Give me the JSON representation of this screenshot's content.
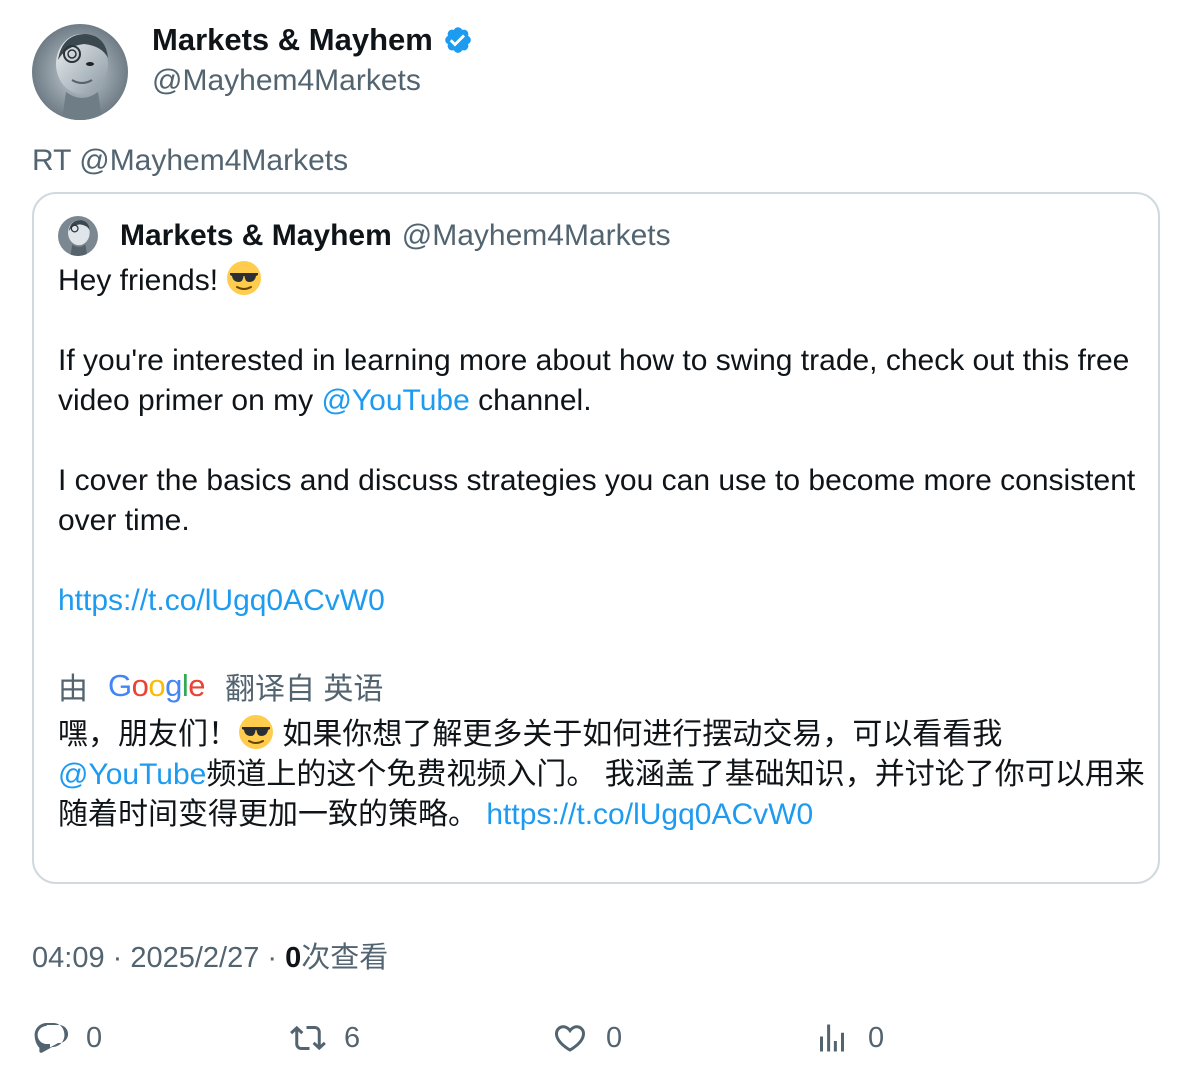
{
  "author": {
    "name": "Markets & Mayhem",
    "handle": "@Mayhem4Markets",
    "verified": true,
    "verified_color": "#1d9bf0"
  },
  "retweet_label": "RT @Mayhem4Markets",
  "quoted": {
    "name": "Markets & Mayhem",
    "handle": "@Mayhem4Markets",
    "line1": "Hey friends!",
    "line1_emoji": "smiling-face-with-sunglasses-icon",
    "para2_a": "If you're interested in learning more about how to swing trade, check out this free video primer on my ",
    "para2_mention": "@YouTube",
    "para2_b": " channel.",
    "para3": "I cover the basics and discuss strategies you can use to become more consistent over time.",
    "link": "https://t.co/lUgq0ACvW0",
    "translation": {
      "prefix": "由",
      "provider": "Google",
      "suffix": "翻译自 英语",
      "part1": "嘿，朋友们！",
      "part2": " 如果你想了解更多关于如何进行摆动交易，可以看看我",
      "mention": "@YouTube",
      "part3": "频道上的这个免费视频入门。 我涵盖了基础知识，并讨论了你可以用来随着时间变得更加一致的策略。 ",
      "link": "https://t.co/lUgq0ACvW0"
    }
  },
  "meta": {
    "time": "04:09",
    "sep1": " · ",
    "date": "2025/2/27",
    "sep2": " · ",
    "views_count": "0",
    "views_label": "次查看"
  },
  "actions": {
    "reply_count": "0",
    "retweet_count": "6",
    "like_count": "0",
    "views_count": "0"
  },
  "colors": {
    "link": "#1d9bf0",
    "secondary_text": "#536471",
    "border": "#cfd9de"
  }
}
